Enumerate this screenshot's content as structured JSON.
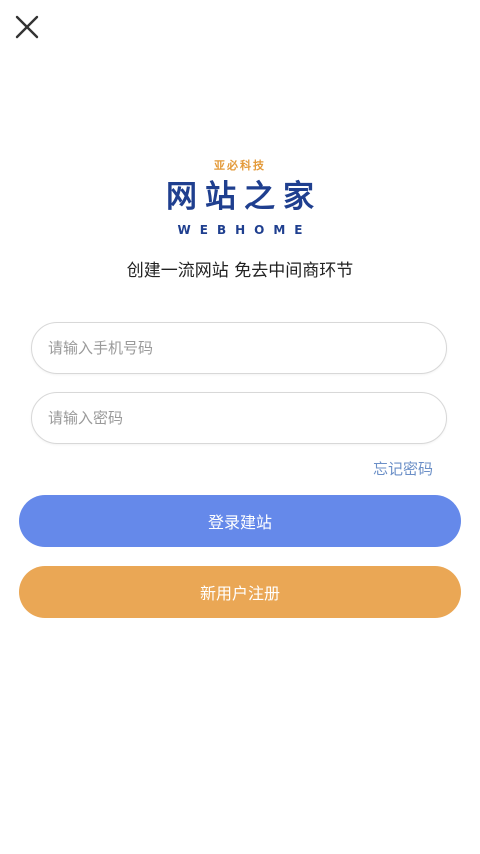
{
  "header": {
    "close_icon": "close-icon"
  },
  "logo": {
    "tagline_small": "亚必科技",
    "main_text": "网站之家",
    "english_text": "WEBHOME"
  },
  "slogan": "创建一流网站 免去中间商环节",
  "form": {
    "phone_placeholder": "请输入手机号码",
    "password_placeholder": "请输入密码",
    "forgot_password": "忘记密码"
  },
  "buttons": {
    "login_label": "登录建站",
    "register_label": "新用户注册"
  },
  "colors": {
    "logo_blue": "#1f3f8f",
    "logo_orange": "#e39a3a",
    "link_blue": "#6b8fc7",
    "login_button": "#6589ea",
    "register_button": "#eaa755"
  }
}
